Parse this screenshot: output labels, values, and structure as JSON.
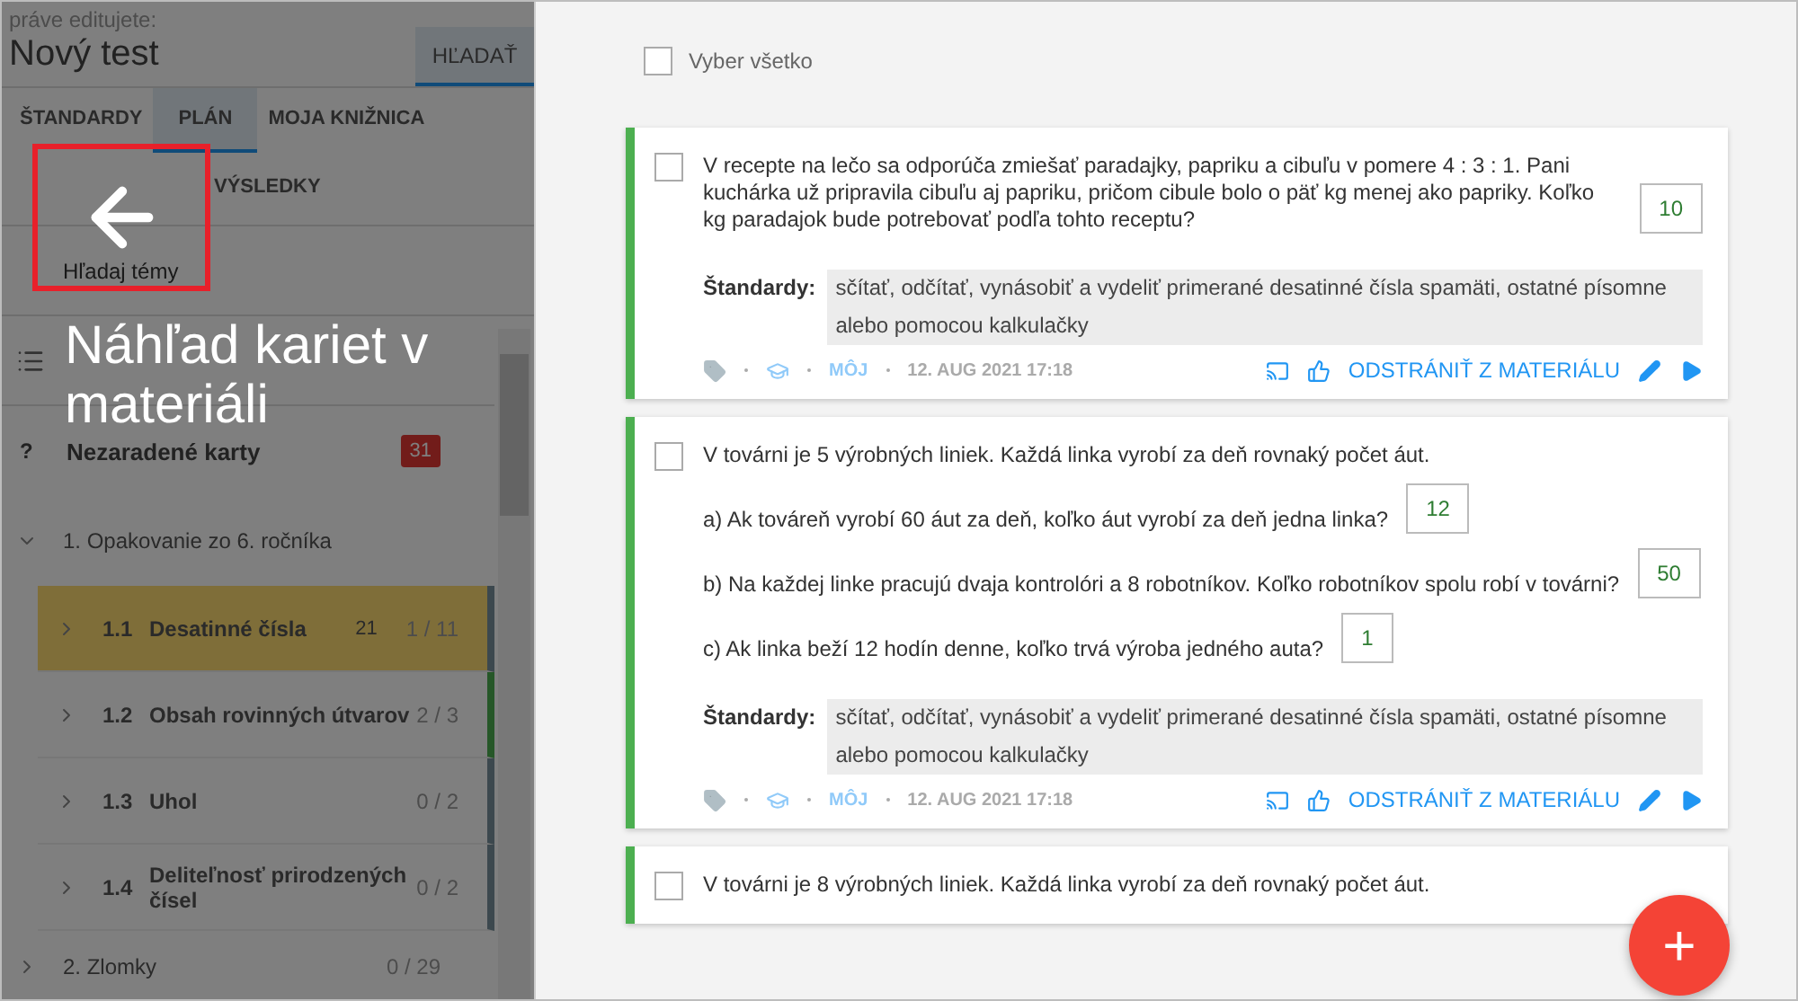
{
  "editing": {
    "caption": "práve editujete:",
    "title": "Nový test",
    "search_button": "HĽADAŤ"
  },
  "tabs": [
    {
      "label": "ŠTANDARDY",
      "selected": false
    },
    {
      "label": "PLÁN",
      "selected": true
    },
    {
      "label": "MOJA KNIŽNICA",
      "selected": false
    },
    {
      "label": "VÝSLEDKY",
      "selected": false
    }
  ],
  "topic_search": {
    "placeholder": "Hľadaj témy"
  },
  "unassigned": {
    "icon_text": "?",
    "label": "Nezaradené karty",
    "count": "31"
  },
  "tree": [
    {
      "label": "1. Opakovanie zo 6. ročníka",
      "expanded": true,
      "children": [
        {
          "number": "1.1",
          "title": "Desatinné čísla",
          "count": "21",
          "progress": "1 / 11",
          "selected": true,
          "active": false
        },
        {
          "number": "1.2",
          "title": "Obsah rovinných útvarov",
          "progress": "2 / 3",
          "selected": false,
          "active": true
        },
        {
          "number": "1.3",
          "title": "Uhol",
          "progress": "0 / 2",
          "selected": false,
          "active": false
        },
        {
          "number": "1.4",
          "title": "Deliteľnosť prirodzených čísel",
          "progress": "0 / 2",
          "selected": false,
          "active": false
        }
      ]
    },
    {
      "label": "2. Zlomky",
      "expanded": false,
      "progress": "0 / 29"
    }
  ],
  "tutorial": {
    "heading": "Náhľad kariet v materiáli"
  },
  "select_all": {
    "label": "Vyber všetko",
    "checked": false
  },
  "cards": [
    {
      "checked": false,
      "parts": [
        {
          "text": "V recepte na lečo sa odporúča zmiešať paradajky, papriku a cibuľu v pomere 4 : 3 : 1. Pani kuchárka už pripravila cibuľu aj papriku, pričom cibule bolo o päť kg menej ako papriky. Koľko kg paradajok bude potrebovať podľa tohto receptu?",
          "answer": "10"
        }
      ],
      "standards_label": "Štandardy:",
      "standards": "sčítať, odčítať, vynásobiť a vydeliť primerané desatinné čísla spamäti, ostatné písomne alebo pomocou kalkulačky",
      "author": "MÔJ",
      "date": "12. AUG 2021 17:18",
      "remove": "ODSTRÁNIŤ Z MATERIÁLU"
    },
    {
      "checked": false,
      "parts": [
        {
          "text": "V továrni je 5 výrobných liniek. Každá linka vyrobí za deň rovnaký počet áut."
        },
        {
          "text": "a) Ak továreň vyrobí 60 áut za deň, koľko áut vyrobí za deň jedna linka?",
          "answer": "12"
        },
        {
          "text": "b) Na každej linke pracujú dvaja kontrolóri a 8 robotníkov. Koľko robotníkov spolu robí v továrni?",
          "answer": "50"
        },
        {
          "text": "c) Ak linka beží 12 hodín denne, koľko trvá výroba jedného auta?",
          "answer": "1"
        }
      ],
      "standards_label": "Štandardy:",
      "standards": "sčítať, odčítať, vynásobiť a vydeliť primerané desatinné čísla spamäti, ostatné písomne alebo pomocou kalkulačky",
      "author": "MÔJ",
      "date": "12. AUG 2021 17:18",
      "remove": "ODSTRÁNIŤ Z MATERIÁLU"
    },
    {
      "checked": false,
      "parts": [
        {
          "text": "V továrni je 8 výrobných liniek. Každá linka vyrobí za deň rovnaký počet áut."
        }
      ]
    }
  ],
  "fab": {
    "symbol": "+"
  }
}
